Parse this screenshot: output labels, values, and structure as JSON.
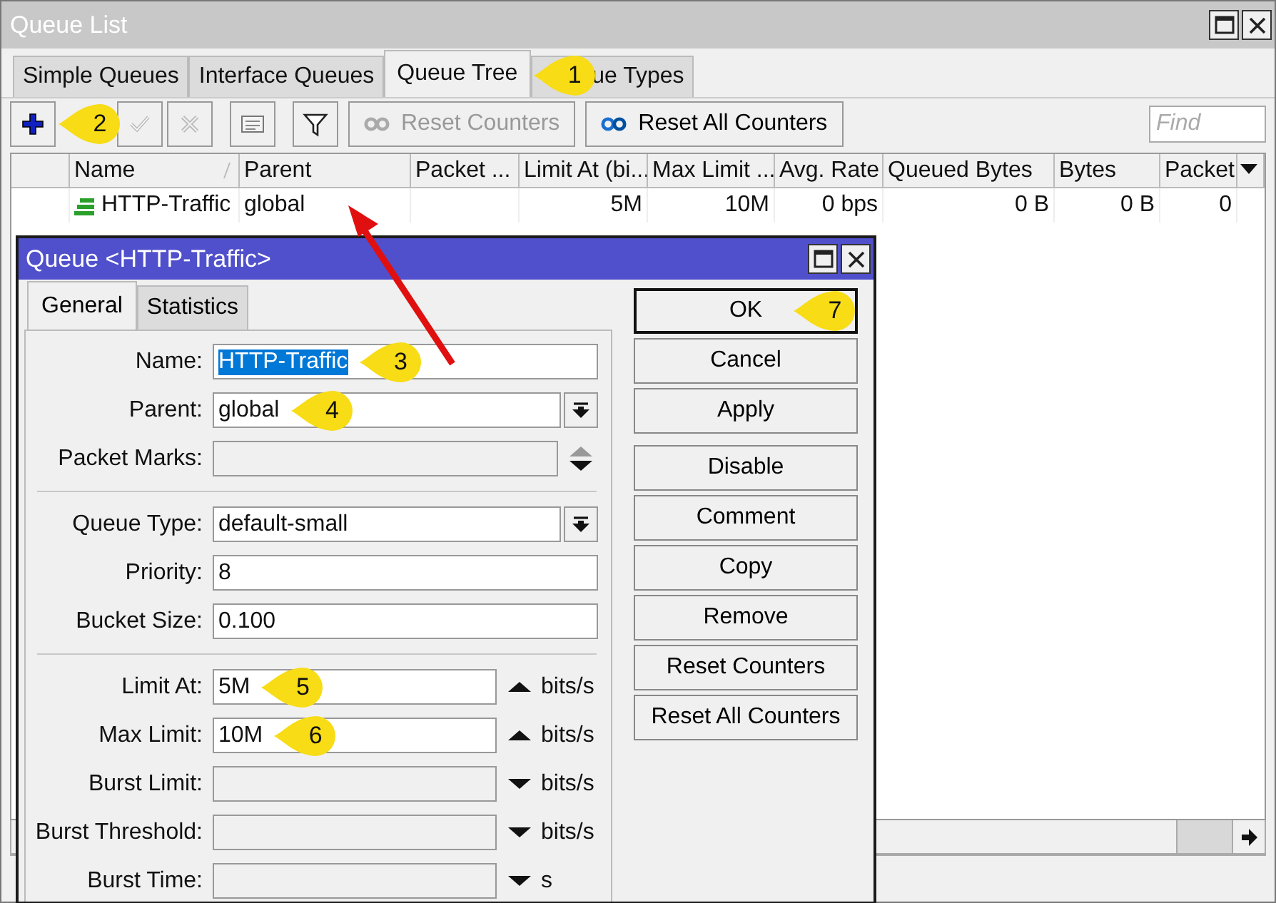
{
  "window": {
    "title": "Queue List"
  },
  "tabs": [
    {
      "label": "Simple Queues",
      "selected": false
    },
    {
      "label": "Interface Queues",
      "selected": false
    },
    {
      "label": "Queue Tree",
      "selected": true,
      "callout": "1"
    },
    {
      "label": "ue Types",
      "selected": false
    }
  ],
  "toolbar": {
    "buttons": [
      {
        "kind": "add",
        "disabled": false,
        "callout": "2"
      },
      {
        "kind": "check",
        "disabled": true
      },
      {
        "kind": "cross",
        "disabled": true
      },
      {
        "kind": "comment",
        "disabled": false
      },
      {
        "kind": "filter",
        "disabled": false
      }
    ],
    "text_buttons": [
      {
        "label": "Reset Counters",
        "disabled": true
      },
      {
        "label": "Reset All Counters",
        "disabled": false
      }
    ],
    "find": {
      "placeholder": "Find"
    }
  },
  "table": {
    "columns": [
      {
        "label": "Name",
        "sorted": true
      },
      {
        "label": "Parent",
        "sorted": false
      },
      {
        "label": "Packet ...",
        "sorted": false
      },
      {
        "label": "Limit At (bi...",
        "sorted": false
      },
      {
        "label": "Max Limit ...",
        "sorted": false
      },
      {
        "label": "Avg. Rate",
        "sorted": false
      },
      {
        "label": "Queued Bytes",
        "sorted": false
      },
      {
        "label": "Bytes",
        "sorted": false
      },
      {
        "label": "Packet",
        "sorted": false
      }
    ],
    "rows": [
      {
        "name": "HTTP-Traffic",
        "parent": "global",
        "limit_at": "5M",
        "max_limit": "10M",
        "avg_rate": "0 bps",
        "queued_bytes": "0 B",
        "bytes": "0 B",
        "packets": "0"
      }
    ]
  },
  "annotation_arrow": true,
  "dialog": {
    "title": "Queue <HTTP-Traffic>",
    "tabs": [
      {
        "label": "General",
        "selected": true
      },
      {
        "label": "Statistics",
        "selected": false
      }
    ],
    "groups": [
      [
        {
          "label": "Name:",
          "kind": "text",
          "value": "HTTP-Traffic",
          "text_selected": true,
          "disabled": false,
          "callout": "3"
        },
        {
          "label": "Parent:",
          "kind": "dropdown",
          "value": "global",
          "disabled": false,
          "callout": "4"
        },
        {
          "label": "Packet Marks:",
          "kind": "updown",
          "disabled": true
        }
      ],
      [
        {
          "label": "Queue Type:",
          "kind": "dropdown",
          "value": "default-small",
          "disabled": false
        },
        {
          "label": "Priority:",
          "kind": "text",
          "value": "8",
          "disabled": false
        },
        {
          "label": "Bucket Size:",
          "kind": "text",
          "value": "0.100",
          "disabled": false
        }
      ],
      [
        {
          "label": "Limit At:",
          "kind": "spin",
          "value": "5M",
          "expanded": true,
          "unit": "bits/s",
          "disabled": false,
          "callout": "5"
        },
        {
          "label": "Max Limit:",
          "kind": "spin",
          "value": "10M",
          "expanded": true,
          "unit": "bits/s",
          "disabled": false,
          "callout": "6"
        },
        {
          "label": "Burst Limit:",
          "kind": "spin",
          "expanded": false,
          "unit": "bits/s",
          "disabled": true
        },
        {
          "label": "Burst Threshold:",
          "kind": "spin",
          "expanded": false,
          "unit": "bits/s",
          "disabled": true
        },
        {
          "label": "Burst Time:",
          "kind": "spin",
          "expanded": false,
          "unit": "s",
          "disabled": true
        }
      ]
    ],
    "buttons": [
      [
        {
          "label": "OK",
          "default": true,
          "callout": "7"
        },
        {
          "label": "Cancel",
          "default": false
        },
        {
          "label": "Apply",
          "default": false
        }
      ],
      [
        {
          "label": "Disable",
          "default": false
        },
        {
          "label": "Comment",
          "default": false
        },
        {
          "label": "Copy",
          "default": false
        },
        {
          "label": "Remove",
          "default": false
        },
        {
          "label": "Reset Counters",
          "default": false
        },
        {
          "label": "Reset All Counters",
          "default": false
        }
      ]
    ]
  }
}
